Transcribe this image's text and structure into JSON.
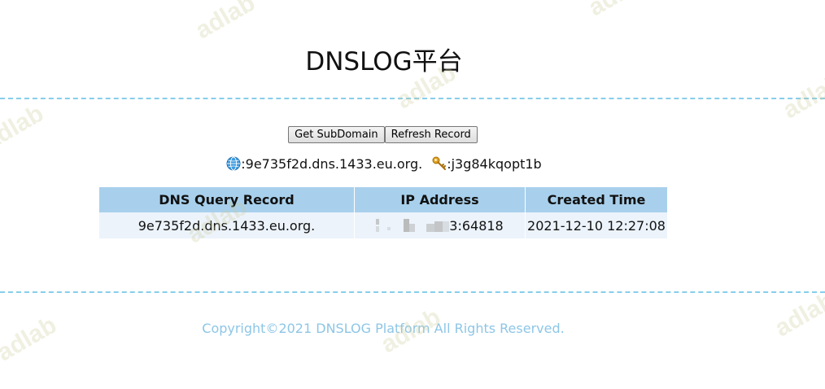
{
  "page": {
    "title": "DNSLOG平台",
    "buttons": {
      "get_subdomain": "Get SubDomain",
      "refresh_record": "Refresh Record"
    },
    "info": {
      "domain_icon": "globe-icon",
      "domain_text": ":9e735f2d.dns.1433.eu.org.",
      "token_icon": "key-icon",
      "token_text": ":j3g84kqopt1b"
    },
    "table": {
      "headers": [
        "DNS Query Record",
        "IP Address",
        "Created Time"
      ],
      "rows": [
        {
          "record": "9e735f2d.dns.1433.eu.org.",
          "ip_visible": "3:64818",
          "created": "2021-12-10 12:27:08"
        }
      ]
    },
    "footer": {
      "copyright": "Copyright©2021 DNSLOG Platform All Rights Reserved."
    },
    "watermark_text": "adlab",
    "colors": {
      "accent_line": "#87ceeb",
      "header_bg": "#a8d0ec",
      "row_bg": "#ecf3fb",
      "copyright": "#8dc6e6"
    }
  }
}
